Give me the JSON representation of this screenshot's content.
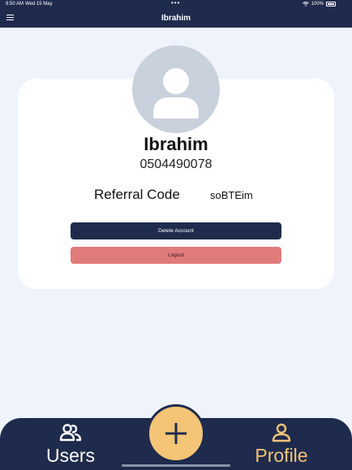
{
  "status_bar": {
    "time": "8:50 AM",
    "date": "Wed 15 May",
    "battery": "100%"
  },
  "header": {
    "title": "Ibrahim",
    "menu_icon": "hamburger-menu-icon"
  },
  "profile": {
    "name": "Ibrahim",
    "phone": "0504490078",
    "referral_label": "Referral Code",
    "referral_code": "soBTEim",
    "avatar_icon": "user-avatar-icon"
  },
  "actions": {
    "delete_label": "Delete Account",
    "logout_label": "Logout"
  },
  "bottom_nav": {
    "items": [
      {
        "label": "Users",
        "icon": "users-icon",
        "active": false
      },
      {
        "label": "Profile",
        "icon": "profile-icon",
        "active": true
      }
    ],
    "fab_icon": "plus-icon"
  },
  "colors": {
    "primary_navy": "#1f2b4d",
    "accent_gold": "#f4c477",
    "danger": "#e07b7b",
    "background": "#eef3fc"
  }
}
